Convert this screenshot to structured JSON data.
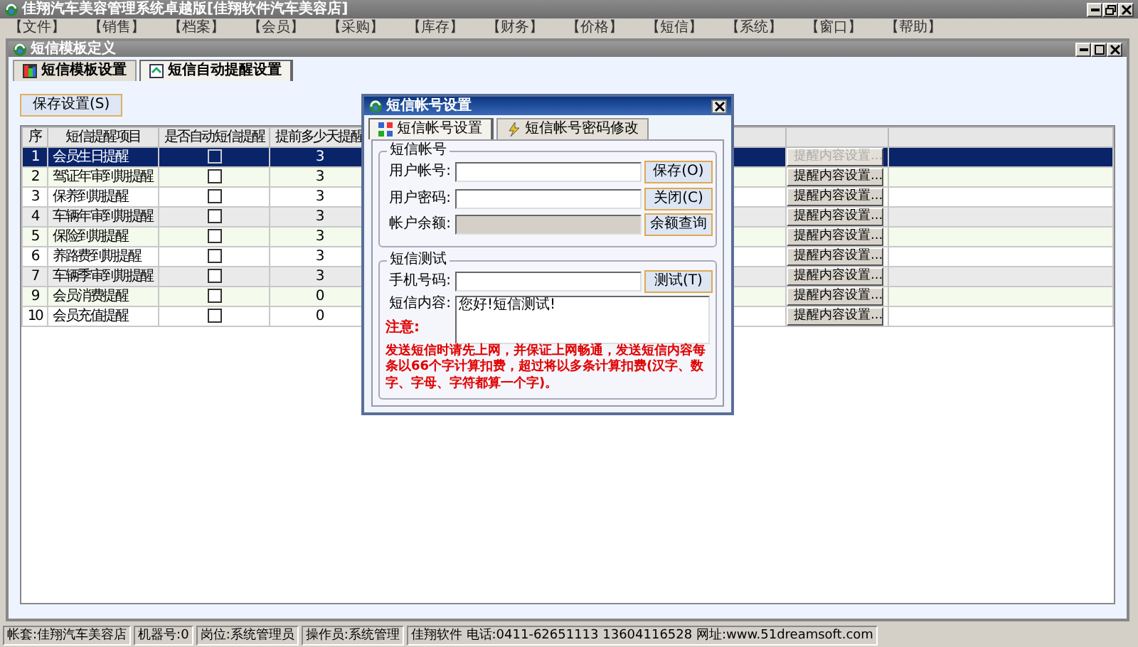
{
  "window": {
    "title": "佳翔汽车美容管理系统卓越版[佳翔软件汽车美容店]"
  },
  "menu": [
    "【文件】",
    "【销售】",
    "【档案】",
    "【会员】",
    "【采购】",
    "【库存】",
    "【财务】",
    "【价格】",
    "【短信】",
    "【系统】",
    "【窗口】",
    "【帮助】"
  ],
  "child_window": {
    "title": "短信模板定义"
  },
  "tabs": [
    {
      "label": "短信模板设置",
      "selected": false
    },
    {
      "label": "短信自动提醒设置",
      "selected": true
    }
  ],
  "save_button": "保存设置(S)",
  "table": {
    "columns": [
      "序",
      "短信提醒项目",
      "是否自动短信提醒",
      "提前多少天提醒"
    ],
    "rows": [
      {
        "no": "1",
        "item": "会员生日提醒",
        "checked": false,
        "days": "3",
        "button": "提醒内容设置...",
        "selected": true
      },
      {
        "no": "2",
        "item": "驾证年审到期提醒",
        "checked": false,
        "days": "3",
        "button": "提醒内容设置...",
        "selected": false
      },
      {
        "no": "3",
        "item": "保养到期提醒",
        "checked": false,
        "days": "3",
        "button": "提醒内容设置...",
        "selected": false
      },
      {
        "no": "4",
        "item": "车辆年审到期提醒",
        "checked": false,
        "days": "3",
        "button": "提醒内容设置...",
        "selected": false
      },
      {
        "no": "5",
        "item": "保险到期提醒",
        "checked": false,
        "days": "3",
        "button": "提醒内容设置...",
        "selected": false
      },
      {
        "no": "6",
        "item": "养路费到期提醒",
        "checked": false,
        "days": "3",
        "button": "提醒内容设置...",
        "selected": false
      },
      {
        "no": "7",
        "item": "车辆季审到期提醒",
        "checked": false,
        "days": "3",
        "button": "提醒内容设置...",
        "selected": false
      },
      {
        "no": "9",
        "item": "会员消费提醒",
        "checked": false,
        "days": "0",
        "button": "提醒内容设置...",
        "selected": false
      },
      {
        "no": "10",
        "item": "会员充值提醒",
        "checked": false,
        "days": "0",
        "button": "提醒内容设置...",
        "selected": false
      }
    ]
  },
  "dialog": {
    "title": "短信帐号设置",
    "tabs": [
      {
        "label": "短信帐号设置",
        "selected": true
      },
      {
        "label": "短信帐号密码修改",
        "selected": false
      }
    ],
    "account_group": {
      "legend": "短信帐号",
      "fields": [
        {
          "label": "用户帐号:",
          "disabled": false,
          "button": "保存(O)"
        },
        {
          "label": "用户密码:",
          "disabled": false,
          "button": "关闭(C)"
        },
        {
          "label": "帐户余额:",
          "disabled": true,
          "button": "余额查询"
        }
      ]
    },
    "test_group": {
      "legend": "短信测试",
      "phone_label": "手机号码:",
      "test_button": "测试(T)",
      "content_label": "短信内容:",
      "content_value": "您好!短信测试!",
      "note_label": "注意:",
      "note": "发送短信时请先上网，并保证上网畅通，发送短信内容每条以66个字计算扣费，超过将以多条计算扣费(汉字、数字、字母、字符都算一个字)。"
    }
  },
  "status_bar": [
    "帐套:佳翔汽车美容店",
    "机器号:0",
    "岗位:系统管理员",
    "操作员:系统管理",
    "佳翔软件 电话:0411-62651113 13604116528 网址:www.51dreamsoft.com"
  ]
}
